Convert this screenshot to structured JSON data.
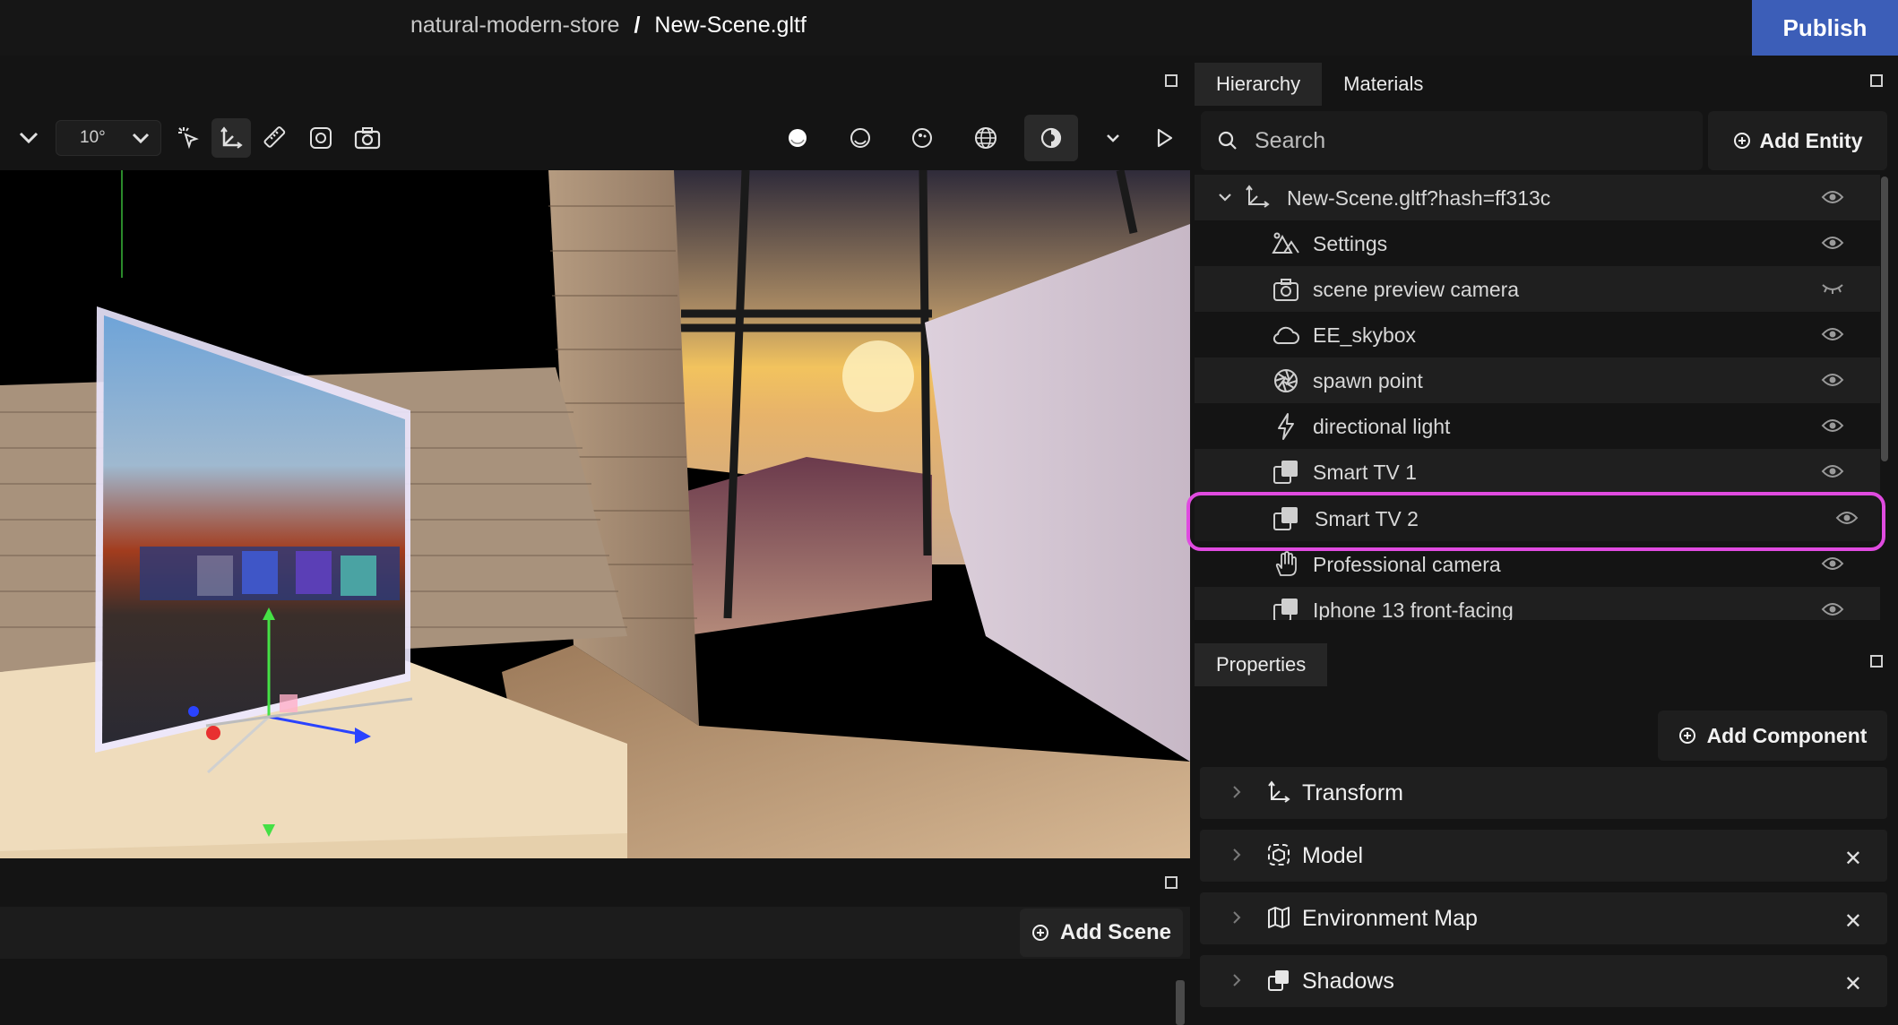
{
  "header": {
    "project": "natural-modern-store",
    "separator": "/",
    "file": "New-Scene.gltf",
    "publish_label": "Publish"
  },
  "toolbar": {
    "snap_angle": "10°"
  },
  "hierarchy": {
    "tabs": [
      "Hierarchy",
      "Materials"
    ],
    "active_tab": "Hierarchy",
    "search_placeholder": "Search",
    "add_entity_label": "Add Entity",
    "items": [
      {
        "label": "New-Scene.gltf?hash=ff313c",
        "icon": "axes-icon",
        "visible": true
      },
      {
        "label": "Settings",
        "icon": "mountains-icon",
        "visible": true
      },
      {
        "label": "scene preview camera",
        "icon": "camera-icon",
        "visible": false
      },
      {
        "label": "EE_skybox",
        "icon": "cloud-icon",
        "visible": true
      },
      {
        "label": "spawn point",
        "icon": "aperture-icon",
        "visible": true
      },
      {
        "label": "directional light",
        "icon": "bolt-icon",
        "visible": true
      },
      {
        "label": "Smart TV 1",
        "icon": "model-icon",
        "visible": true
      },
      {
        "label": "Smart TV 2",
        "icon": "model-icon",
        "visible": true,
        "selected": true
      },
      {
        "label": "Professional camera",
        "icon": "hand-icon",
        "visible": true
      },
      {
        "label": "Iphone 13 front-facing",
        "icon": "model-icon",
        "visible": true
      }
    ]
  },
  "properties": {
    "tab_label": "Properties",
    "add_component_label": "Add Component",
    "components": [
      {
        "label": "Transform",
        "icon": "axes-icon",
        "removable": false
      },
      {
        "label": "Model",
        "icon": "model-cube-icon",
        "removable": true
      },
      {
        "label": "Environment Map",
        "icon": "map-icon",
        "removable": true
      },
      {
        "label": "Shadows",
        "icon": "shadow-icon",
        "removable": true
      }
    ]
  },
  "scenes": {
    "add_scene_label": "Add Scene"
  },
  "colors": {
    "accent": "#3c5eb8",
    "selection": "#e04be0"
  }
}
